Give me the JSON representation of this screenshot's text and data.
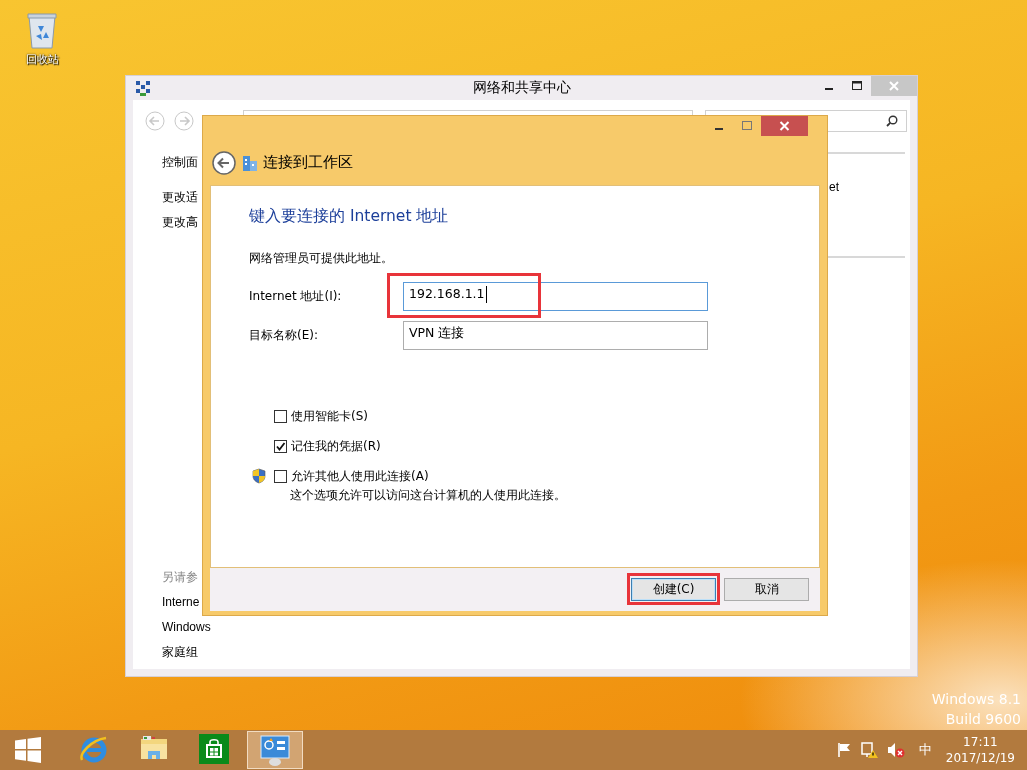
{
  "desktop": {
    "icons": [
      {
        "label": "回收站"
      }
    ],
    "edition_lines": [
      "Windows 8.1",
      "Build 9600"
    ]
  },
  "background_window": {
    "title": "网络和共享中心",
    "left_pane": {
      "links": [
        "控制面",
        "更改适",
        "更改高"
      ],
      "see_also_heading": "另请参",
      "see_also": [
        "Interne",
        "Windows",
        "家庭组"
      ]
    },
    "right_fragment": "et"
  },
  "dialog": {
    "title": "连接到工作区",
    "heading": "键入要连接的 Internet 地址",
    "intro": "网络管理员可提供此地址。",
    "fields": [
      {
        "label": "Internet 地址(I):",
        "value": "192.168.1.1",
        "focused": true,
        "highlighted": true
      },
      {
        "label": "目标名称(E):",
        "value": "VPN 连接",
        "focused": false,
        "highlighted": false
      }
    ],
    "options": [
      {
        "label": "使用智能卡(S)",
        "checked": false,
        "shield": false
      },
      {
        "label": "记住我的凭据(R)",
        "checked": true,
        "shield": false
      },
      {
        "label": "允许其他人使用此连接(A)",
        "checked": false,
        "shield": true,
        "note": "这个选项允许可以访问这台计算机的人使用此连接。"
      }
    ],
    "buttons": [
      {
        "label": "创建(C)",
        "default": true,
        "highlighted": true
      },
      {
        "label": "取消",
        "default": false,
        "highlighted": false
      }
    ]
  },
  "taskbar": {
    "apps": [
      {
        "kind": "browser",
        "active": false
      },
      {
        "kind": "folder",
        "active": false
      },
      {
        "kind": "store",
        "active": false
      },
      {
        "kind": "control-panel",
        "active": true
      }
    ],
    "tray": {
      "ime": "中",
      "time": "17:11",
      "date": "2017/12/19"
    }
  }
}
